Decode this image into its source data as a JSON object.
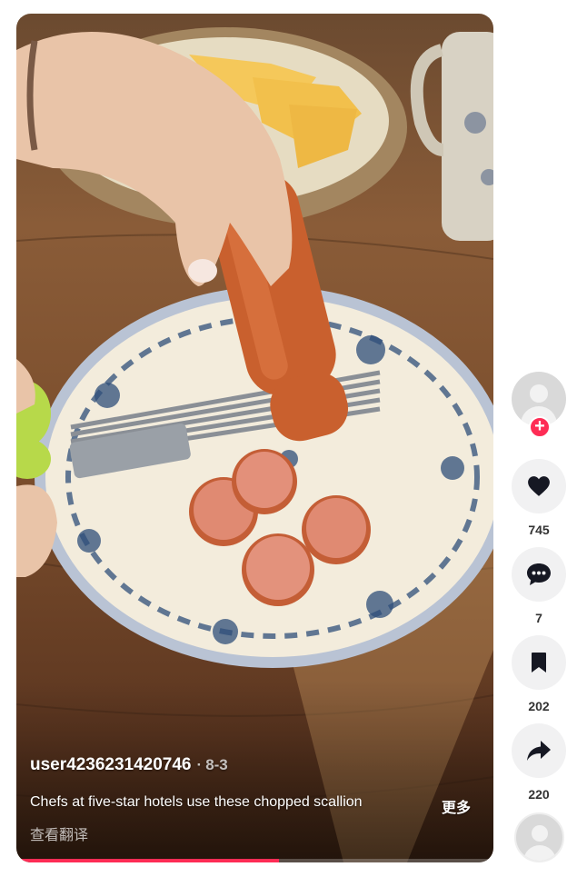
{
  "video": {
    "author": "user4236231420746",
    "separator": "·",
    "date": "8-3",
    "caption": "Chefs at five-star hotels use these chopped scallion",
    "more_label": "更多",
    "translate_label": "查看翻译",
    "progress_fraction": 0.55
  },
  "actions": {
    "follow_symbol": "+",
    "like": {
      "icon": "heart-icon",
      "count": "745"
    },
    "comment": {
      "icon": "comment-icon",
      "count": "7"
    },
    "save": {
      "icon": "bookmark-icon",
      "count": "202"
    },
    "share": {
      "icon": "share-icon",
      "count": "220"
    }
  },
  "colors": {
    "accent": "#fe2c55",
    "button_bg": "#f1f1f2",
    "icon": "#161823",
    "count_text": "#333333"
  }
}
